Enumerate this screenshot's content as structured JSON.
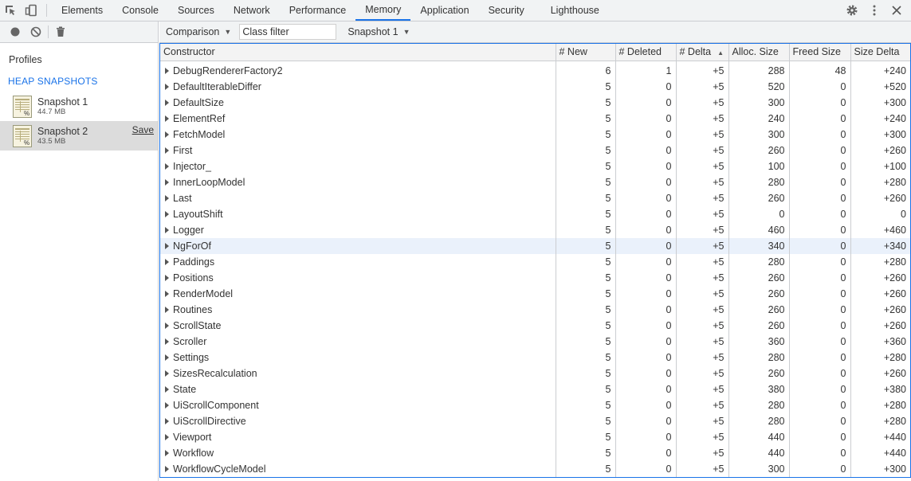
{
  "tabs": [
    {
      "label": "Elements"
    },
    {
      "label": "Console"
    },
    {
      "label": "Sources"
    },
    {
      "label": "Network"
    },
    {
      "label": "Performance"
    },
    {
      "label": "Memory"
    },
    {
      "label": "Application"
    },
    {
      "label": "Security"
    },
    {
      "label": "Lighthouse"
    }
  ],
  "active_tab": "Memory",
  "left": {
    "profiles_title": "Profiles",
    "section_title": "HEAP SNAPSHOTS",
    "snapshots": [
      {
        "name": "Snapshot 1",
        "size": "44.7 MB"
      },
      {
        "name": "Snapshot 2",
        "size": "43.5 MB",
        "save": "Save"
      }
    ]
  },
  "toolbar": {
    "view_mode": "Comparison",
    "filter_placeholder": "Class filter",
    "base_snapshot": "Snapshot 1"
  },
  "table": {
    "columns": [
      "Constructor",
      "# New",
      "# Deleted",
      "# Delta",
      "Alloc. Size",
      "Freed Size",
      "Size Delta"
    ],
    "sort_indicator": "▲",
    "rows": [
      [
        "DebugRendererFactory2",
        "6",
        "1",
        "+5",
        "288",
        "48",
        "+240"
      ],
      [
        "DefaultIterableDiffer",
        "5",
        "0",
        "+5",
        "520",
        "0",
        "+520"
      ],
      [
        "DefaultSize",
        "5",
        "0",
        "+5",
        "300",
        "0",
        "+300"
      ],
      [
        "ElementRef",
        "5",
        "0",
        "+5",
        "240",
        "0",
        "+240"
      ],
      [
        "FetchModel",
        "5",
        "0",
        "+5",
        "300",
        "0",
        "+300"
      ],
      [
        "First",
        "5",
        "0",
        "+5",
        "260",
        "0",
        "+260"
      ],
      [
        "Injector_",
        "5",
        "0",
        "+5",
        "100",
        "0",
        "+100"
      ],
      [
        "InnerLoopModel",
        "5",
        "0",
        "+5",
        "280",
        "0",
        "+280"
      ],
      [
        "Last",
        "5",
        "0",
        "+5",
        "260",
        "0",
        "+260"
      ],
      [
        "LayoutShift",
        "5",
        "0",
        "+5",
        "0",
        "0",
        "0"
      ],
      [
        "Logger",
        "5",
        "0",
        "+5",
        "460",
        "0",
        "+460"
      ],
      [
        "NgForOf",
        "5",
        "0",
        "+5",
        "340",
        "0",
        "+340"
      ],
      [
        "Paddings",
        "5",
        "0",
        "+5",
        "280",
        "0",
        "+280"
      ],
      [
        "Positions",
        "5",
        "0",
        "+5",
        "260",
        "0",
        "+260"
      ],
      [
        "RenderModel",
        "5",
        "0",
        "+5",
        "260",
        "0",
        "+260"
      ],
      [
        "Routines",
        "5",
        "0",
        "+5",
        "260",
        "0",
        "+260"
      ],
      [
        "ScrollState",
        "5",
        "0",
        "+5",
        "260",
        "0",
        "+260"
      ],
      [
        "Scroller",
        "5",
        "0",
        "+5",
        "360",
        "0",
        "+360"
      ],
      [
        "Settings",
        "5",
        "0",
        "+5",
        "280",
        "0",
        "+280"
      ],
      [
        "SizesRecalculation",
        "5",
        "0",
        "+5",
        "260",
        "0",
        "+260"
      ],
      [
        "State",
        "5",
        "0",
        "+5",
        "380",
        "0",
        "+380"
      ],
      [
        "UiScrollComponent",
        "5",
        "0",
        "+5",
        "280",
        "0",
        "+280"
      ],
      [
        "UiScrollDirective",
        "5",
        "0",
        "+5",
        "280",
        "0",
        "+280"
      ],
      [
        "Viewport",
        "5",
        "0",
        "+5",
        "440",
        "0",
        "+440"
      ],
      [
        "Workflow",
        "5",
        "0",
        "+5",
        "440",
        "0",
        "+440"
      ],
      [
        "WorkflowCycleModel",
        "5",
        "0",
        "+5",
        "300",
        "0",
        "+300"
      ]
    ],
    "highlighted_row": "NgForOf"
  },
  "icons": {
    "inspect": "inspect-element-icon",
    "device": "device-toolbar-icon",
    "settings": "gear-icon",
    "more": "more-vertical-icon",
    "close": "close-icon",
    "record": "record-icon",
    "clear": "clear-icon",
    "delete": "trash-icon"
  },
  "colors": {
    "accent": "#1a73e8",
    "highlight": "#eaf1fb",
    "selected": "#dcdcdc"
  }
}
